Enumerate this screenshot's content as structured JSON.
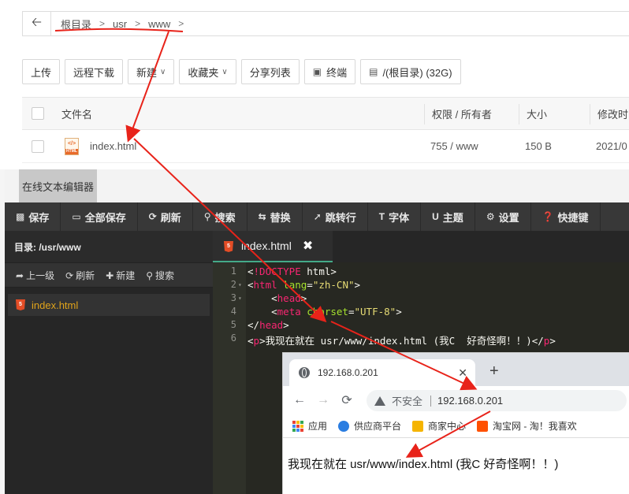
{
  "file_manager": {
    "back_icon": "arrow-left-icon",
    "breadcrumb": [
      "根目录",
      "usr",
      "www"
    ],
    "toolbar": {
      "upload": "上传",
      "remote_download": "远程下载",
      "new": "新建",
      "favorites": "收藏夹",
      "share_list": "分享列表",
      "terminal": "终端",
      "disk": "/(根目录) (32G)"
    },
    "columns": {
      "filename": "文件名",
      "permission": "权限 / 所有者",
      "size": "大小",
      "modified": "修改时"
    },
    "rows": [
      {
        "name": "index.html",
        "permission": "755 / www",
        "size": "150 B",
        "modified": "2021/0"
      }
    ]
  },
  "editor": {
    "window_title": "在线文本编辑器",
    "toolbar": [
      "保存",
      "全部保存",
      "刷新",
      "搜索",
      "替换",
      "跳转行",
      "字体",
      "主题",
      "设置",
      "快捷键"
    ],
    "sidebar": {
      "dir_label": "目录: /usr/www",
      "actions": [
        "上一级",
        "刷新",
        "新建",
        "搜索"
      ],
      "file": "index.html"
    },
    "tab": {
      "name": "index.html",
      "close": "✖"
    },
    "code_lines": [
      {
        "n": "1",
        "fold": "",
        "text": "<!DOCTYPE html>"
      },
      {
        "n": "2",
        "fold": "▾",
        "text": "<html lang=\"zh-CN\">"
      },
      {
        "n": "3",
        "fold": "▾",
        "text": "    <head>"
      },
      {
        "n": "4",
        "fold": "",
        "text": "    <meta charset=\"UTF-8\">"
      },
      {
        "n": "5",
        "fold": "",
        "text": "</head>"
      },
      {
        "n": "6",
        "fold": "",
        "text": "<p>我现在就在 usr/www/index.html (我C  好奇怪啊！！)</p>"
      }
    ]
  },
  "browser": {
    "tab_title": "192.168.0.201",
    "tab_close": "✕",
    "new_tab": "+",
    "insecure_label": "不安全",
    "url": "192.168.0.201",
    "bookmarks": [
      "应用",
      "供应商平台",
      "商家中心",
      "淘宝网 - 淘！我喜欢"
    ],
    "page_text": "我现在就在 usr/www/index.html (我C 好奇怪啊！！)"
  },
  "colors": {
    "annotation": "#e8231a",
    "editor_bg": "#272822",
    "sidebar_file": "#e0a31a"
  }
}
